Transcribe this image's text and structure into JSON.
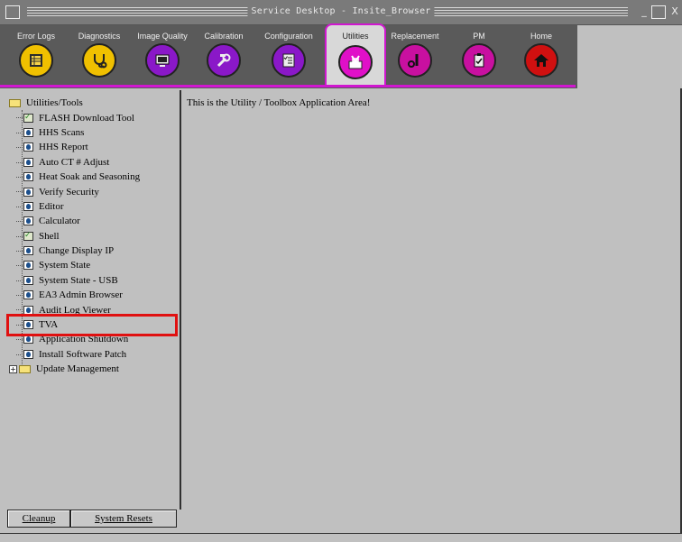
{
  "window": {
    "title": "Service Desktop - Insite_Browser",
    "min_glyph": "_",
    "max_glyph": "□",
    "close_glyph": "X"
  },
  "tabs": [
    {
      "label": "Error Logs",
      "icon": "log-sheet-icon",
      "color": "#f0c000"
    },
    {
      "label": "Diagnostics",
      "icon": "stethoscope-icon",
      "color": "#f0c000"
    },
    {
      "label": "Image Quality",
      "icon": "monitor-icon",
      "color": "#8a18c8"
    },
    {
      "label": "Calibration",
      "icon": "wrench-icon",
      "color": "#8a18c8"
    },
    {
      "label": "Configuration",
      "icon": "checklist-icon",
      "color": "#8a18c8"
    },
    {
      "label": "Utilities",
      "icon": "toolbox-icon",
      "color": "#e010c8",
      "active": true
    },
    {
      "label": "Replacement",
      "icon": "tools-icon",
      "color": "#c810a0"
    },
    {
      "label": "PM",
      "icon": "clipboard-icon",
      "color": "#c810a0"
    },
    {
      "label": "Home",
      "icon": "house-icon",
      "color": "#d01010"
    }
  ],
  "tree": {
    "root": "Utilities/Tools",
    "items": [
      {
        "label": "FLASH Download Tool",
        "icon": "shell"
      },
      {
        "label": "HHS Scans",
        "icon": "doc"
      },
      {
        "label": "HHS Report",
        "icon": "doc"
      },
      {
        "label": "Auto CT # Adjust",
        "icon": "doc"
      },
      {
        "label": "Heat Soak and Seasoning",
        "icon": "doc"
      },
      {
        "label": "Verify Security",
        "icon": "doc"
      },
      {
        "label": "Editor",
        "icon": "doc"
      },
      {
        "label": "Calculator",
        "icon": "doc"
      },
      {
        "label": "Shell",
        "icon": "shell"
      },
      {
        "label": "Change Display IP",
        "icon": "doc"
      },
      {
        "label": "System State",
        "icon": "doc"
      },
      {
        "label": "System State - USB",
        "icon": "doc"
      },
      {
        "label": "EA3 Admin Browser",
        "icon": "doc"
      },
      {
        "label": "Audit Log Viewer",
        "icon": "doc"
      },
      {
        "label": "TVA",
        "icon": "doc"
      },
      {
        "label": "Application Shutdown",
        "icon": "doc"
      },
      {
        "label": "Install Software Patch",
        "icon": "doc"
      }
    ],
    "collapsed_folder": "Update Management"
  },
  "buttons": {
    "cleanup": "Cleanup",
    "system_resets": "System Resets"
  },
  "content": {
    "message": "This is the Utility / Toolbox Application Area!"
  }
}
